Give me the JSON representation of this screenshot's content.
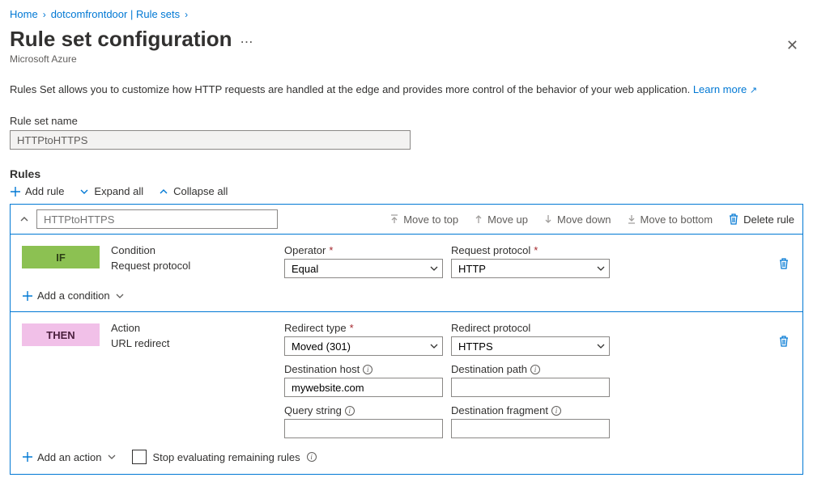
{
  "breadcrumb": {
    "home": "Home",
    "ruleSets": "dotcomfrontdoor | Rule sets"
  },
  "page": {
    "title": "Rule set configuration",
    "subtitle": "Microsoft Azure",
    "description": "Rules Set allows you to customize how HTTP requests are handled at the edge and provides more control of the behavior of your web application.",
    "learnMore": "Learn more"
  },
  "ruleSetNameLabel": "Rule set name",
  "ruleSetName": "HTTPtoHTTPS",
  "sections": {
    "rules": "Rules"
  },
  "toolbar": {
    "addRule": "Add rule",
    "expandAll": "Expand all",
    "collapseAll": "Collapse all"
  },
  "ruleHeader": {
    "namePlaceholder": "HTTPtoHTTPS",
    "moveTop": "Move to top",
    "moveUp": "Move up",
    "moveDown": "Move down",
    "moveBottom": "Move to bottom",
    "deleteRule": "Delete rule"
  },
  "ifBlock": {
    "badge": "IF",
    "conditionHeading": "Condition",
    "conditionValue": "Request protocol",
    "operatorLabel": "Operator",
    "operatorValue": "Equal",
    "protocolLabel": "Request protocol",
    "protocolValue": "HTTP",
    "addCondition": "Add a condition"
  },
  "thenBlock": {
    "badge": "THEN",
    "actionHeading": "Action",
    "actionValue": "URL redirect",
    "redirectTypeLabel": "Redirect type",
    "redirectTypeValue": "Moved (301)",
    "redirectProtocolLabel": "Redirect protocol",
    "redirectProtocolValue": "HTTPS",
    "destHostLabel": "Destination host",
    "destHostValue": "mywebsite.com",
    "destPathLabel": "Destination path",
    "destPathValue": "",
    "queryLabel": "Query string",
    "queryValue": "",
    "fragmentLabel": "Destination fragment",
    "fragmentValue": "",
    "addAction": "Add an action",
    "stopEvaluating": "Stop evaluating remaining rules"
  }
}
